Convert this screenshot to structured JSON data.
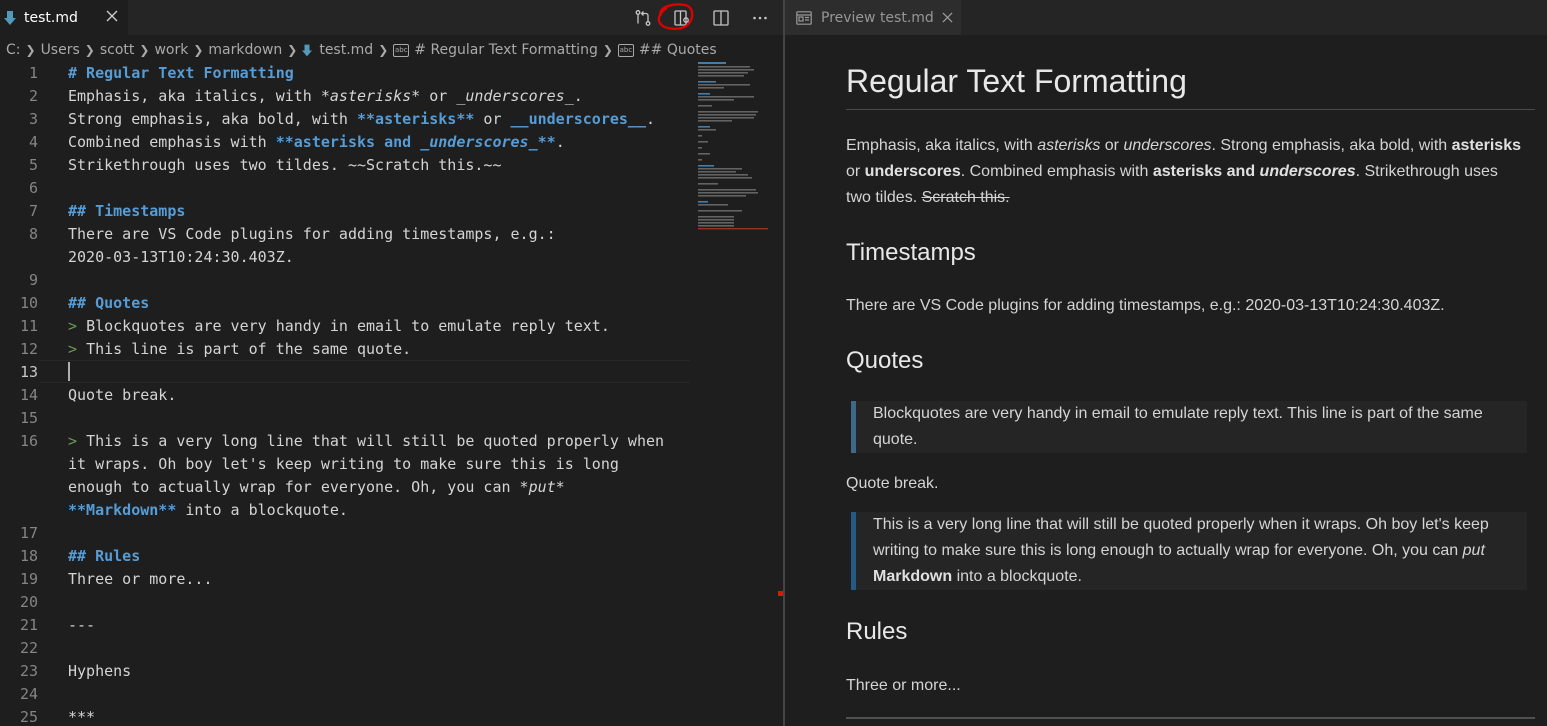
{
  "editor": {
    "tab": {
      "label": "test.md"
    },
    "breadcrumb": [
      "C:",
      "Users",
      "scott",
      "work",
      "markdown",
      "test.md",
      "# Regular Text Formatting",
      "## Quotes"
    ],
    "lines": [
      {
        "n": "1",
        "segs": [
          [
            "h",
            "# Regular Text Formatting"
          ]
        ]
      },
      {
        "n": "2",
        "segs": [
          [
            "t",
            "Emphasis, aka italics, with "
          ],
          [
            "it",
            "*asterisks*"
          ],
          [
            "t",
            " or "
          ],
          [
            "it",
            "_underscores_"
          ],
          [
            "t",
            "."
          ]
        ]
      },
      {
        "n": "3",
        "segs": [
          [
            "t",
            "Strong emphasis, aka bold, with "
          ],
          [
            "b",
            "**asterisks**"
          ],
          [
            "t",
            " or "
          ],
          [
            "b",
            "__underscores__"
          ],
          [
            "t",
            "."
          ]
        ]
      },
      {
        "n": "4",
        "segs": [
          [
            "t",
            "Combined emphasis with "
          ],
          [
            "b",
            "**asterisks and "
          ],
          [
            "bi",
            "_underscores_"
          ],
          [
            "b",
            "**"
          ],
          [
            "t",
            "."
          ]
        ]
      },
      {
        "n": "5",
        "segs": [
          [
            "t",
            "Strikethrough uses two tildes. ~~Scratch this.~~"
          ]
        ]
      },
      {
        "n": "6",
        "segs": []
      },
      {
        "n": "7",
        "segs": [
          [
            "h",
            "## Timestamps"
          ]
        ]
      },
      {
        "n": "8",
        "segs": [
          [
            "t",
            "There are VS Code plugins for adding timestamps, e.g.:"
          ]
        ]
      },
      {
        "n": "",
        "segs": [
          [
            "t",
            "2020-03-13T10:24:30.403Z."
          ]
        ]
      },
      {
        "n": "9",
        "segs": []
      },
      {
        "n": "10",
        "segs": [
          [
            "h",
            "## Quotes"
          ]
        ]
      },
      {
        "n": "11",
        "segs": [
          [
            "q",
            "> "
          ],
          [
            "t",
            "Blockquotes are very handy in email to emulate reply text."
          ]
        ]
      },
      {
        "n": "12",
        "segs": [
          [
            "q",
            "> "
          ],
          [
            "t",
            "This line is part of the same quote."
          ]
        ]
      },
      {
        "n": "13",
        "segs": []
      },
      {
        "n": "14",
        "segs": [
          [
            "t",
            "Quote break."
          ]
        ]
      },
      {
        "n": "15",
        "segs": []
      },
      {
        "n": "16",
        "segs": [
          [
            "q",
            "> "
          ],
          [
            "t",
            "This is a very long line that will still be quoted properly when"
          ]
        ]
      },
      {
        "n": "",
        "segs": [
          [
            "t",
            "it wraps. Oh boy let's keep writing to make sure this is long"
          ]
        ]
      },
      {
        "n": "",
        "segs": [
          [
            "t",
            "enough to actually wrap for everyone. Oh, you can "
          ],
          [
            "it",
            "*put*"
          ]
        ]
      },
      {
        "n": "",
        "segs": [
          [
            "b",
            "**Markdown**"
          ],
          [
            "t",
            " into a blockquote."
          ]
        ]
      },
      {
        "n": "17",
        "segs": []
      },
      {
        "n": "18",
        "segs": [
          [
            "h",
            "## Rules"
          ]
        ]
      },
      {
        "n": "19",
        "segs": [
          [
            "t",
            "Three or more..."
          ]
        ]
      },
      {
        "n": "20",
        "segs": []
      },
      {
        "n": "21",
        "segs": [
          [
            "t",
            "---"
          ]
        ]
      },
      {
        "n": "22",
        "segs": []
      },
      {
        "n": "23",
        "segs": [
          [
            "t",
            "Hyphens"
          ]
        ]
      },
      {
        "n": "24",
        "segs": []
      },
      {
        "n": "25",
        "segs": [
          [
            "t",
            "***"
          ]
        ]
      }
    ],
    "active_line": "13"
  },
  "preview": {
    "tab": {
      "label": "Preview test.md"
    },
    "h1": "Regular Text Formatting",
    "para1": [
      [
        "t",
        "Emphasis, aka italics, with "
      ],
      [
        "i",
        "asterisks"
      ],
      [
        "t",
        " or "
      ],
      [
        "i",
        "underscores"
      ],
      [
        "t",
        ". Strong emphasis, aka bold, with "
      ],
      [
        "b",
        "asterisks"
      ],
      [
        "t",
        " or "
      ],
      [
        "b",
        "underscores"
      ],
      [
        "t",
        ". Combined emphasis with "
      ],
      [
        "b",
        "asterisks and "
      ],
      [
        "bi",
        "underscores"
      ],
      [
        "t",
        ". Strikethrough uses two tildes. "
      ],
      [
        "s",
        "Scratch this."
      ]
    ],
    "h2_timestamps": "Timestamps",
    "para_timestamps": "There are VS Code plugins for adding timestamps, e.g.: 2020-03-13T10:24:30.403Z.",
    "h2_quotes": "Quotes",
    "quote1": "Blockquotes are very handy in email to emulate reply text. This line is part of the same quote.",
    "quote_break": "Quote break.",
    "quote2": [
      [
        "t",
        "This is a very long line that will still be quoted properly when it wraps. Oh boy let's keep writing to make sure this is long enough to actually wrap for everyone. Oh, you can "
      ],
      [
        "i",
        "put"
      ],
      [
        "t",
        " "
      ],
      [
        "b",
        "Markdown"
      ],
      [
        "t",
        " into a blockquote."
      ]
    ],
    "h2_rules": "Rules",
    "para_rules": "Three or more..."
  },
  "colors": {
    "accent_blue": "#569cd6",
    "quote_green": "#6a9955",
    "annotation_red": "#e00000"
  },
  "icons": [
    "markdown-file-icon",
    "close-icon",
    "open-changes-icon",
    "open-preview-to-side-icon",
    "split-editor-icon",
    "more-actions-icon",
    "symbol-string-icon",
    "preview-icon"
  ]
}
